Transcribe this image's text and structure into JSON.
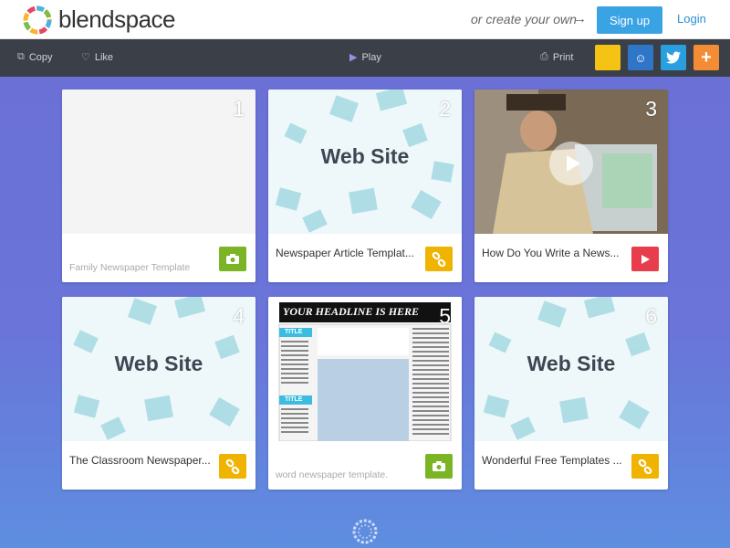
{
  "header": {
    "brand": "blendspace",
    "create_text": "or create your own",
    "signup_label": "Sign up",
    "login_label": "Login"
  },
  "toolbar": {
    "copy_label": "Copy",
    "like_label": "Like",
    "play_label": "Play",
    "print_label": "Print",
    "share_buttons": [
      {
        "name": "yellow-share",
        "color": "#f5c314"
      },
      {
        "name": "classroom-share",
        "color": "#2f76c9"
      },
      {
        "name": "twitter-share",
        "color": "#2a9fe0"
      },
      {
        "name": "add-share",
        "color": "#f48b35"
      }
    ]
  },
  "tiles": [
    {
      "number": "1",
      "caption": "Family Newspaper Template",
      "caption_style": "light",
      "type": "blank",
      "badge": "camera",
      "badge_color": "green"
    },
    {
      "number": "2",
      "caption": "Newspaper Article Templat...",
      "caption_style": "normal",
      "type": "website",
      "thumb_text": "Web Site",
      "badge": "link",
      "badge_color": "yellow"
    },
    {
      "number": "3",
      "caption": "How Do You Write a News...",
      "caption_style": "normal",
      "type": "video",
      "badge": "play",
      "badge_color": "red"
    },
    {
      "number": "4",
      "caption": "The Classroom Newspaper...",
      "caption_style": "normal",
      "type": "website",
      "thumb_text": "Web Site",
      "badge": "link",
      "badge_color": "yellow"
    },
    {
      "number": "5",
      "caption": "word newspaper template.",
      "caption_style": "light",
      "type": "newspaper",
      "thumb_text": "YOUR HEADLINE IS HERE",
      "title_label": "TITLE",
      "badge": "camera",
      "badge_color": "green"
    },
    {
      "number": "6",
      "caption": "Wonderful Free Templates ...",
      "caption_style": "normal",
      "type": "website",
      "thumb_text": "Web Site",
      "badge": "link",
      "badge_color": "yellow"
    }
  ]
}
